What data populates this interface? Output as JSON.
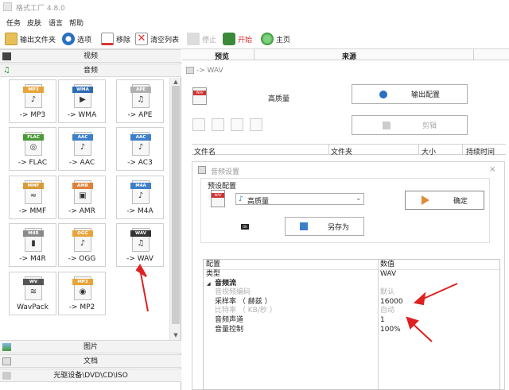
{
  "app": {
    "title": "格式工厂 4.8.0"
  },
  "menu": {
    "items": [
      "任务",
      "皮肤",
      "语言",
      "帮助"
    ]
  },
  "toolbar": {
    "output_folder": "输出文件夹",
    "options": "选项",
    "remove": "移除",
    "clear_list": "清空列表",
    "stop": "停止",
    "start": "开始",
    "home": "主页"
  },
  "categories": {
    "video": "视频",
    "audio": "音频",
    "image": "图片",
    "document": "文档",
    "optical": "光驱设备\\DVD\\CD\\ISO"
  },
  "audio_formats": [
    {
      "caption": "-> MP3",
      "badge": "MP3",
      "color": "#e8a43a",
      "glyph": "♪"
    },
    {
      "caption": "-> WMA",
      "badge": "WMA",
      "color": "#2d6bb3",
      "glyph": "▶"
    },
    {
      "caption": "-> APE",
      "badge": "APE",
      "color": "#b0b0b0",
      "glyph": "♫"
    },
    {
      "caption": "-> FLAC",
      "badge": "FLAC",
      "color": "#4a9a3a",
      "glyph": "◎"
    },
    {
      "caption": "-> AAC",
      "badge": "AAC",
      "color": "#3d7fc9",
      "glyph": "♪"
    },
    {
      "caption": "-> AC3",
      "badge": "AAC",
      "color": "#3d7fc9",
      "glyph": "♪"
    },
    {
      "caption": "-> MMF",
      "badge": "MMF",
      "color": "#d99a3a",
      "glyph": "≈"
    },
    {
      "caption": "-> AMR",
      "badge": "AMR",
      "color": "#e0803a",
      "glyph": "▣"
    },
    {
      "caption": "-> M4A",
      "badge": "M4A",
      "color": "#3d7fc9",
      "glyph": "♪"
    },
    {
      "caption": "-> M4R",
      "badge": "M4R",
      "color": "#8a8a8a",
      "glyph": "▮"
    },
    {
      "caption": "-> OGG",
      "badge": "OGG",
      "color": "#e8a43a",
      "glyph": "♪"
    },
    {
      "caption": "-> WAV",
      "badge": "WAV",
      "color": "#333333",
      "glyph": "♫"
    },
    {
      "caption": "WavPack",
      "badge": "WV",
      "color": "#555555",
      "glyph": "≋"
    },
    {
      "caption": "-> MP2",
      "badge": "MP3",
      "color": "#e8a43a",
      "glyph": "◉"
    }
  ],
  "right": {
    "col_preview": "预览",
    "col_source": "来源",
    "target": "-> WAV",
    "quality": "高质量",
    "output_config": "输出配置",
    "clip": "剪辑",
    "file_cols": [
      "文件名",
      "文件夹",
      "大小",
      "持续时间"
    ]
  },
  "dialog": {
    "title": "音频设置",
    "preset_label": "预设配置",
    "preset_value": "高质量",
    "ok": "确定",
    "save_as": "另存为",
    "grid_head_key": "配置",
    "grid_head_val": "数值",
    "rows": [
      {
        "k": "类型",
        "v": "WAV",
        "dim": false,
        "indent": false
      },
      {
        "k": "音频流",
        "v": "",
        "dim": false,
        "indent": false,
        "group": true
      },
      {
        "k": "音视频编码",
        "v": "默认",
        "dim": true,
        "indent": true
      },
      {
        "k": "采样率 （ 赫兹 ）",
        "v": "16000",
        "dim": false,
        "indent": true
      },
      {
        "k": "比特率 （ KB/秒 ）",
        "v": "自动",
        "dim": true,
        "indent": true
      },
      {
        "k": "音频声道",
        "v": "1",
        "dim": false,
        "indent": true
      },
      {
        "k": "音量控制",
        "v": "100%",
        "dim": false,
        "indent": true
      }
    ]
  }
}
